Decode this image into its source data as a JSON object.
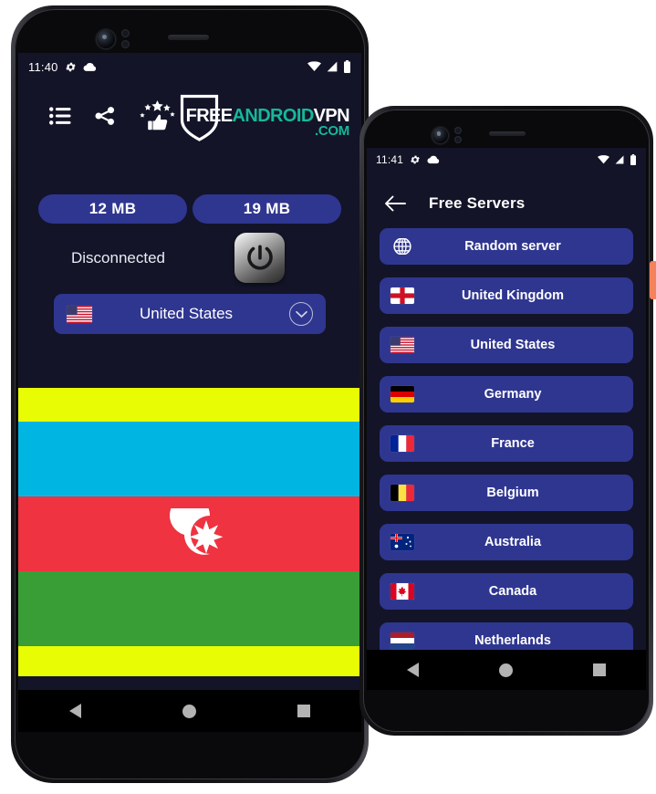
{
  "phone1": {
    "status_bar": {
      "time": "11:40",
      "icons_left": [
        "gear-icon",
        "cloud-icon"
      ],
      "icons_right": [
        "wifi-icon",
        "signal-icon",
        "battery-icon"
      ]
    },
    "toolbar": {
      "icons": [
        {
          "name": "list-icon",
          "label": "Server list"
        },
        {
          "name": "share-icon",
          "label": "Share"
        },
        {
          "name": "rate-icon",
          "label": "Rate us"
        }
      ]
    },
    "logo": {
      "part1": "FREE",
      "part2": "ANDROID",
      "part3": "VPN",
      "part4": ".COM",
      "shield": "shield-icon",
      "accent_color": "#15b89a"
    },
    "data_pills": [
      {
        "value": "12 MB",
        "name": "download-usage"
      },
      {
        "value": "19 MB",
        "name": "upload-usage"
      }
    ],
    "connection": {
      "status": "Disconnected",
      "power_button": "power-icon"
    },
    "server_select": {
      "flag": "us-flag-icon",
      "label": "United States",
      "chevron": "chevron-down-icon"
    },
    "ad_banner": {
      "color": "#e8fc03",
      "flag_name": "azerbaijan-flag",
      "flag_colors": {
        "blue": "#00b5e2",
        "red": "#ef3340",
        "green": "#389e35"
      }
    },
    "nav_bar": [
      "back-triangle-icon",
      "home-circle-icon",
      "recents-square-icon"
    ]
  },
  "phone2": {
    "status_bar": {
      "time": "11:41",
      "icons_left": [
        "gear-icon",
        "cloud-icon"
      ],
      "icons_right": [
        "wifi-icon",
        "signal-icon",
        "battery-icon"
      ]
    },
    "app_bar": {
      "back": "back-arrow-icon",
      "title": "Free Servers"
    },
    "servers": [
      {
        "label": "Random server",
        "flag": "globe-icon"
      },
      {
        "label": "United Kingdom",
        "flag": "uk-flag-icon"
      },
      {
        "label": "United States",
        "flag": "us-flag-icon"
      },
      {
        "label": "Germany",
        "flag": "de-flag-icon"
      },
      {
        "label": "France",
        "flag": "fr-flag-icon"
      },
      {
        "label": "Belgium",
        "flag": "be-flag-icon"
      },
      {
        "label": "Australia",
        "flag": "au-flag-icon"
      },
      {
        "label": "Canada",
        "flag": "ca-flag-icon"
      },
      {
        "label": "Netherlands",
        "flag": "nl-flag-icon"
      },
      {
        "label": "",
        "flag": "partial-item"
      }
    ],
    "edge_strip_color": "#f4825c",
    "nav_bar": [
      "back-triangle-icon",
      "home-circle-icon",
      "recents-square-icon"
    ]
  },
  "theme": {
    "app_background": "#131428",
    "item_blue": "#2f3690",
    "text_white": "#ffffff"
  }
}
